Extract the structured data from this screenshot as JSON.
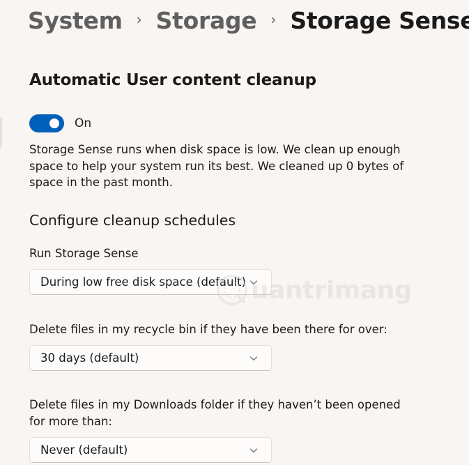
{
  "breadcrumb": {
    "items": [
      "System",
      "Storage",
      "Storage Sense"
    ],
    "separator": "›"
  },
  "auto_cleanup": {
    "title": "Automatic User content cleanup",
    "toggle_state": "On",
    "toggle_on": true,
    "description": "Storage Sense runs when disk space is low. We clean up enough space to help your system run its best. We cleaned up 0 bytes of space in the past month."
  },
  "schedules": {
    "title": "Configure cleanup schedules",
    "run_label": "Run Storage Sense",
    "run_value": "During low free disk space (default)",
    "recycle_label": "Delete files in my recycle bin if they have been there for over:",
    "recycle_value": "30 days (default)",
    "downloads_label": "Delete files in my Downloads folder if they haven’t been opened for more than:",
    "downloads_value": "Never (default)"
  },
  "watermark": {
    "text": "uantrimang"
  },
  "colors": {
    "accent": "#005fb8",
    "background": "#f9f5f2",
    "text": "#1b1b1b",
    "muted": "#5f5f5f"
  },
  "icons": [
    "chevron-right-icon",
    "chevron-down-icon",
    "watermark-logo-icon"
  ]
}
